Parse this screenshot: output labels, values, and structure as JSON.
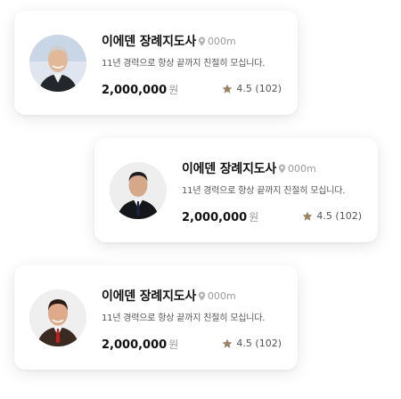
{
  "cards": [
    {
      "name": "이에덴 장례지도사",
      "distance": "000m",
      "description": "11년 경력으로 항상 끝까지 친절히 모십니다.",
      "price": "2,000,000",
      "currency": "원",
      "rating": "4.5 (102)"
    },
    {
      "name": "이에덴 장례지도사",
      "distance": "000m",
      "description": "11년 경력으로 항상 끝까지 친절히 모십니다.",
      "price": "2,000,000",
      "currency": "원",
      "rating": "4.5 (102)"
    },
    {
      "name": "이에덴 장례지도사",
      "distance": "000m",
      "description": "11년 경력으로 항상 끝까지 친절히 모십니다.",
      "price": "2,000,000",
      "currency": "원",
      "rating": "4.5 (102)"
    }
  ],
  "colors": {
    "star": "#9b8262",
    "muted": "#9a9a9a",
    "text": "#111111"
  }
}
